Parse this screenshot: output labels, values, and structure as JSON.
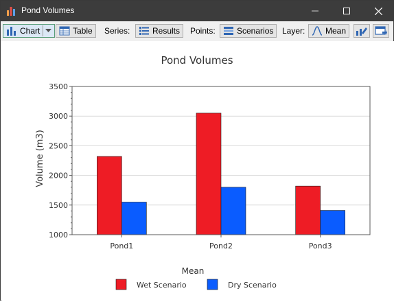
{
  "window": {
    "title": "Pond Volumes",
    "minimize_icon": "minimize-icon",
    "maximize_icon": "maximize-icon",
    "close_icon": "close-icon"
  },
  "toolbar": {
    "chart_label": "Chart",
    "table_label": "Table",
    "series_label": "Series:",
    "series_value": "Results",
    "points_label": "Points:",
    "points_value": "Scenarios",
    "layer_label": "Layer:",
    "layer_value": "Mean"
  },
  "colors": {
    "wet": "#ee1c25",
    "dry": "#0a5cff"
  },
  "chart_data": {
    "type": "bar",
    "title": "Pond Volumes",
    "xlabel": "",
    "ylabel": "Volume (m3)",
    "categories": [
      "Pond1",
      "Pond2",
      "Pond3"
    ],
    "ylim": [
      1000,
      3500
    ],
    "yticks": [
      1000,
      1500,
      2000,
      2500,
      3000,
      3500
    ],
    "grid": true,
    "legend_title": "Mean",
    "legend_position": "bottom",
    "series": [
      {
        "name": "Wet Scenario",
        "color": "#ee1c25",
        "values": [
          2320,
          3050,
          1820
        ]
      },
      {
        "name": "Dry Scenario",
        "color": "#0a5cff",
        "values": [
          1550,
          1800,
          1410
        ]
      }
    ]
  }
}
